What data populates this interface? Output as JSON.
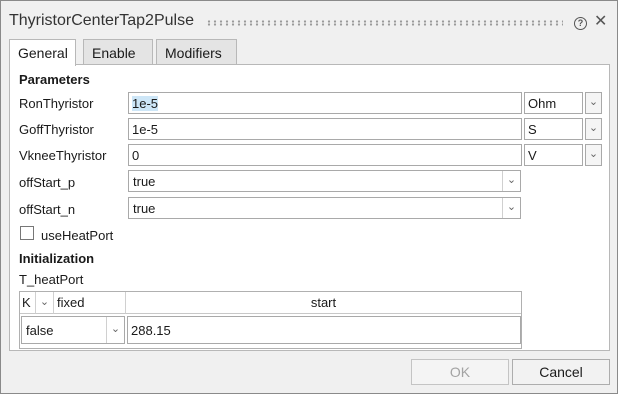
{
  "window": {
    "title": "ThyristorCenterTap2Pulse"
  },
  "icons": {
    "help": "help-icon",
    "close": "close-icon"
  },
  "tabs": [
    {
      "label": "General",
      "active": true
    },
    {
      "label": "Enable",
      "active": false
    },
    {
      "label": "Modifiers",
      "active": false
    }
  ],
  "parameters": {
    "title": "Parameters",
    "rows": [
      {
        "label": "RonThyristor",
        "value": "1e-5",
        "unit": "Ohm"
      },
      {
        "label": "GoffThyristor",
        "value": "1e-5",
        "unit": "S"
      },
      {
        "label": "VkneeThyristor",
        "value": "0",
        "unit": "V"
      },
      {
        "label": "offStart_p",
        "value": "true"
      },
      {
        "label": "offStart_n",
        "value": "true"
      }
    ],
    "use_heat_port": {
      "label": "useHeatPort",
      "checked": false
    }
  },
  "initialization": {
    "title": "Initialization",
    "t_heatport": {
      "label": "T_heatPort",
      "unit": "K",
      "fixed_header": "fixed",
      "start_header": "start",
      "fixed_value": "false",
      "start_value": "288.15"
    }
  },
  "buttons": {
    "ok": "OK",
    "cancel": "Cancel"
  },
  "colors": {
    "dialog_bg": "#f0f0f0",
    "panel_bg": "#ffffff",
    "selection": "#cde6f7"
  }
}
